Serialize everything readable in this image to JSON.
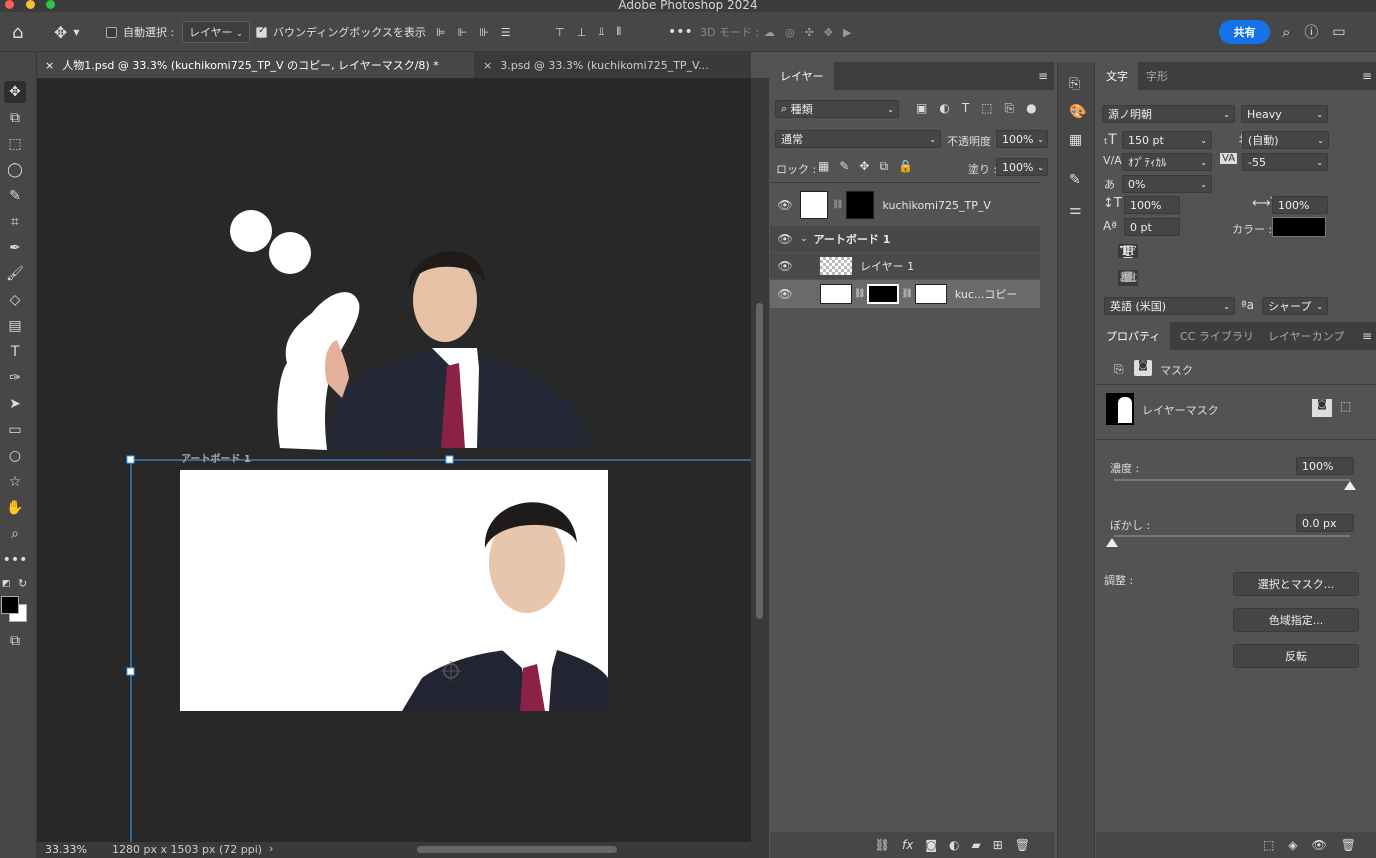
{
  "app": {
    "title": "Adobe Photoshop 2024"
  },
  "options": {
    "auto_select_label": "自動選択 :",
    "auto_select_target": "レイヤー",
    "bounding_box_label": "バウンディングボックスを表示",
    "mode_3d_label": "3D モード :",
    "share_label": "共有"
  },
  "doc_tabs": [
    {
      "label": "人物1.psd @ 33.3% (kuchikomi725_TP_V のコピー, レイヤーマスク/8) *"
    },
    {
      "label": "3.psd @ 33.3% (kuchikomi725_TP_V..."
    }
  ],
  "canvas": {
    "artboard_label": "アートボード 1"
  },
  "status": {
    "zoom": "33.33%",
    "doc_info": "1280 px x 1503 px (72 ppi)"
  },
  "layers_panel": {
    "tab_label": "レイヤー",
    "filter_kind": "種類",
    "blend_mode": "通常",
    "opacity_label": "不透明度 :",
    "opacity_value": "100%",
    "lock_label": "ロック :",
    "fill_label": "塗り :",
    "fill_value": "100%",
    "layers": [
      {
        "name": "kuchikomi725_TP_V"
      },
      {
        "name": "アートボード 1"
      },
      {
        "name": "レイヤー 1"
      },
      {
        "name": "kuc...コピー"
      }
    ]
  },
  "char_panel": {
    "tab_char": "文字",
    "tab_para": "字形",
    "font_family": "源ノ明朝",
    "font_style": "Heavy",
    "font_size": "150 pt",
    "leading": "(自動)",
    "kerning": "ｵﾌﾟﾃｨｶﾙ",
    "tracking": "-55",
    "tsume": "0%",
    "vscale": "100%",
    "hscale": "100%",
    "baseline": "0 pt",
    "color_label": "カラー :",
    "color_value": "#000000",
    "language": "英語 (米国)",
    "aa_label": "a",
    "antialias": "シャープ"
  },
  "props_panel": {
    "tab_props": "プロパティ",
    "tab_cc": "CC ライブラリ",
    "tab_comps": "レイヤーカンプ",
    "mask_label": "マスク",
    "layer_mask_label": "レイヤーマスク",
    "density_label": "濃度 :",
    "density_value": "100%",
    "feather_label": "ぼかし :",
    "feather_value": "0.0 px",
    "adjust_label": "調整 :",
    "select_mask_btn": "選択とマスク...",
    "color_range_btn": "色域指定...",
    "invert_btn": "反転"
  }
}
